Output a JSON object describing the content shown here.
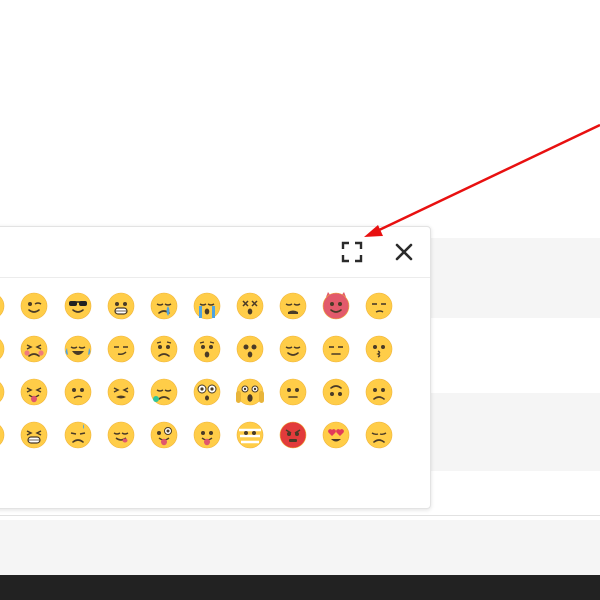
{
  "colors": {
    "face": "#ffcd48",
    "face_stroke": "#f0b43a",
    "feature": "#4a3b27",
    "tongue": "#e0566d",
    "blush": "#f07c7c",
    "tear": "#4fa3e0",
    "angry_face": "#e23b3b",
    "devil_face": "#e25a6b",
    "annotation_arrow": "#e81010",
    "header_icon": "#2b2b2b"
  },
  "popup": {
    "expand_icon": "fullscreen-expand-icon",
    "close_icon": "close-x-icon",
    "emoji_rows": [
      [
        "grinning-sweat",
        "winking",
        "sunglasses",
        "grimacing",
        "crying-sad",
        "sobbing",
        "dizzy-face",
        "weary",
        "smiling-devil",
        "unamused"
      ],
      [
        "neutral-partial",
        "flushed-squint",
        "joy-tears",
        "smirk",
        "worried",
        "hushed",
        "astonished",
        "relieved",
        "expressionless",
        "kissing"
      ],
      [
        "neutral-edge",
        "tongue-squint",
        "confused",
        "tired",
        "drooling",
        "wide-eyed",
        "screaming",
        "neutral",
        "upside-down",
        "frowning"
      ],
      [
        "grin-edge",
        "big-grin",
        "sad-sweat",
        "yum",
        "zany",
        "tongue-out",
        "mummy-face",
        "angry-red",
        "heart-eyes",
        "pensive"
      ]
    ]
  }
}
